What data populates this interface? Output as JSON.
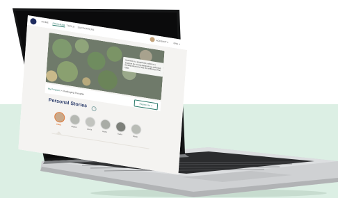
{
  "nav": {
    "items": [
      "HOME",
      "PROGRAM",
      "TOOLS",
      "SUPPORTERS"
    ],
    "active_index": 1,
    "account_label": "ACCOUNT ∨",
    "language_label": "ENG ∨"
  },
  "hero": {
    "quote": "Aesthetic is a paraphrase, which is a structure for seeing and thinking, and those thinking structures help the wellbeing of the child."
  },
  "breadcrumb": {
    "root": "My Program",
    "separator": " > ",
    "current": "Challenging Thoughts"
  },
  "register_button": "Register for ∨",
  "section": {
    "title": "Personal Stories",
    "info_icon": "info-icon"
  },
  "stories": [
    {
      "name": "Clara",
      "active": true
    },
    {
      "name": "Martin",
      "active": false
    },
    {
      "name": "Laura",
      "active": false
    },
    {
      "name": "Hans",
      "active": false
    },
    {
      "name": "Karin",
      "active": false
    },
    {
      "name": "Marie",
      "active": false
    }
  ],
  "colors": {
    "accent": "#2a7a6a",
    "active_story": "#e07a3a",
    "background_band": "#dcefe4",
    "title": "#2a3b6a"
  }
}
